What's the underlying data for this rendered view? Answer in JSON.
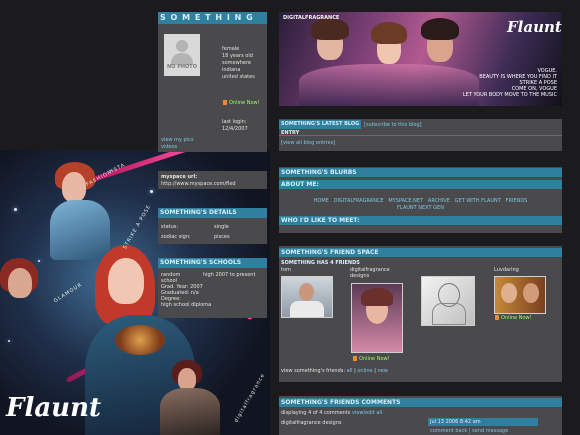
{
  "profile": {
    "name": "S O M E T H I N G",
    "photo_label": "NO PHOTO",
    "info_lines": [
      "female",
      "18 years old",
      "somewhere",
      "indiana",
      "united states"
    ],
    "online_label": "Online Now!",
    "last_login_label": "last login:",
    "last_login_date": "12/4/2007",
    "view_pics_label": "view my pics",
    "videos_label": "videos",
    "url_label": "myspace url:",
    "url_value": "http://www.myspace.com/fled"
  },
  "details": {
    "header": "SOMETHING'S DETAILS",
    "rows": [
      {
        "label": "status:",
        "value": "single"
      },
      {
        "label": "zodiac sign:",
        "value": "pisces"
      }
    ]
  },
  "schools": {
    "header": "SOMETHING'S SCHOOLS",
    "lines": [
      "random",
      "school",
      "Grad. Year: 2007",
      "Graduated: n/a",
      "Degree:",
      "high school diploma"
    ],
    "years": "high 2007 to present"
  },
  "banner": {
    "site_label": "DIGITALFRAGRANCE",
    "logo": "Flaunt",
    "lyrics": [
      "VOGUE.",
      "BEAUTY IS WHERE YOU FIND IT",
      "STRIKE A POSE",
      "COME ON, VOGUE",
      "LET YOUR BODY MOVE TO THE MUSIC"
    ]
  },
  "blog": {
    "header": "SOMETHING'S LATEST BLOG ENTRY",
    "subscribe": "[subscribe to this blog]",
    "view_all": "[view all blog entries]"
  },
  "blurbs": {
    "header": "SOMETHING'S BLURBS",
    "about_label": "ABOUT ME:",
    "about_links": [
      "HOME",
      "DIGITALFRAGRANCE",
      "MYSPACE.NET",
      "ARCHIVE",
      "GET WITH FLAUNT",
      "FRIENDS"
    ],
    "about_second": "FLAUNT NEXT GEN",
    "meet_label": "WHO I'D LIKE TO MEET:"
  },
  "friends": {
    "header": "SOMETHING'S FRIEND SPACE",
    "count_text": "SOMETHING HAS 4 FRIENDS",
    "list": [
      {
        "name": "tom",
        "online": false
      },
      {
        "name": "digitalfragrance designs",
        "online": true
      },
      {
        "name": "",
        "online": false
      },
      {
        "name": "Luvdaring",
        "online": true
      }
    ],
    "online_label": "Online Now!",
    "view_text": "view something's friends:",
    "view_links": [
      "all",
      "online",
      "new"
    ]
  },
  "comments": {
    "header": "SOMETHING'S FRIENDS COMMENTS",
    "displaying": "displaying 4 of 4 comments",
    "view_edit": "view/edit all",
    "author": "digitalfragrance designs",
    "date": "Jul 13 2006 8:42 am",
    "actions": "comment back | send message"
  },
  "art": {
    "logo": "Flaunt",
    "labels": [
      "FASHIONISTA",
      "STRIKE A POSE",
      "GLAMOUR",
      "digitalfragrance"
    ]
  }
}
